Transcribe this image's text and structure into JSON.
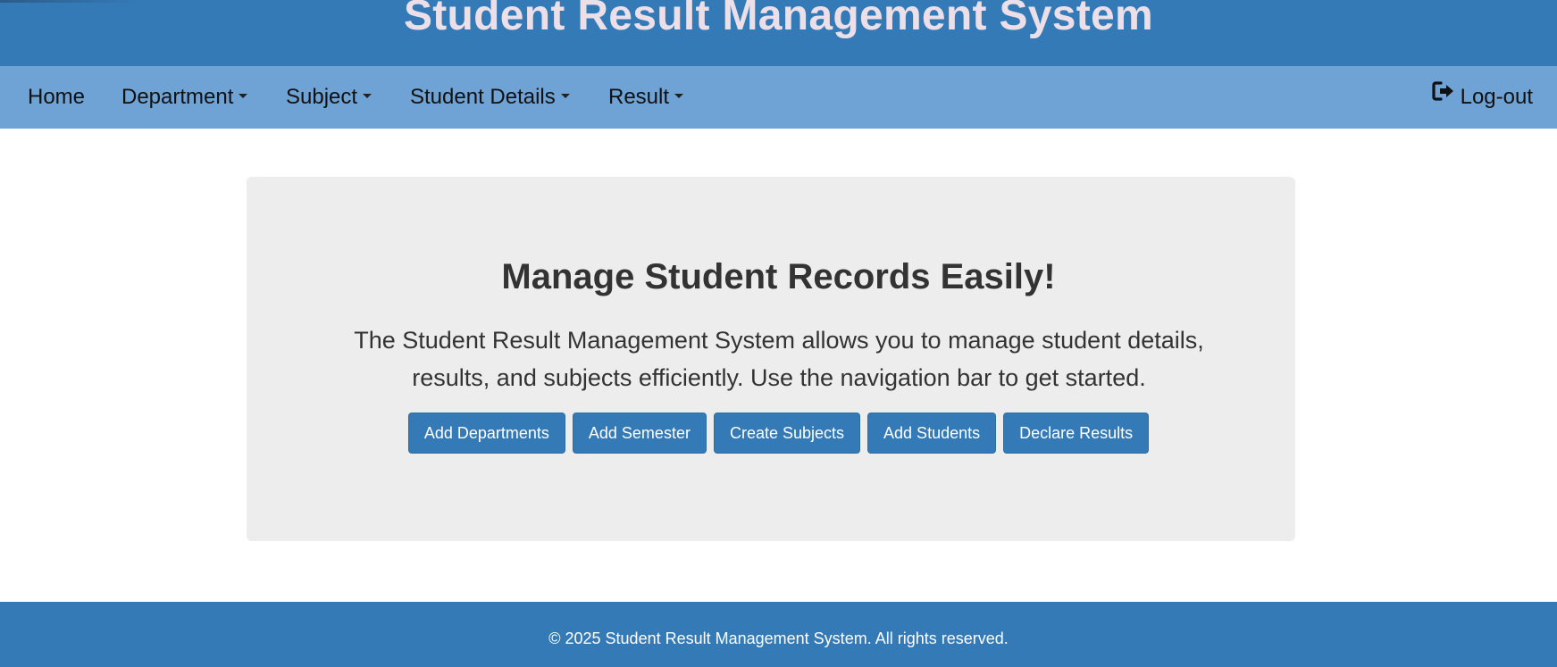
{
  "header": {
    "title": "Student Result Management System"
  },
  "navbar": {
    "items": [
      {
        "label": "Home",
        "dropdown": false
      },
      {
        "label": "Department",
        "dropdown": true
      },
      {
        "label": "Subject",
        "dropdown": true
      },
      {
        "label": "Student Details",
        "dropdown": true
      },
      {
        "label": "Result",
        "dropdown": true
      }
    ],
    "logout": {
      "label": "Log-out",
      "icon": "sign-out-icon"
    }
  },
  "hero": {
    "heading": "Manage Student Records Easily!",
    "text_line1": "The Student Result Management System allows you to manage student details,",
    "text_line2": "results, and subjects efficiently. Use the navigation bar to get started.",
    "buttons": [
      {
        "label": "Add Departments"
      },
      {
        "label": "Add Semester"
      },
      {
        "label": "Create Subjects"
      },
      {
        "label": "Add Students"
      },
      {
        "label": "Declare Results"
      }
    ]
  },
  "footer": {
    "text": "© 2025 Student Result Management System. All rights reserved."
  },
  "colors": {
    "primary": "#337ab7",
    "navbar": "#6fa2d5",
    "header_text": "#ecdfe8",
    "jumbotron_bg": "#ededed"
  }
}
